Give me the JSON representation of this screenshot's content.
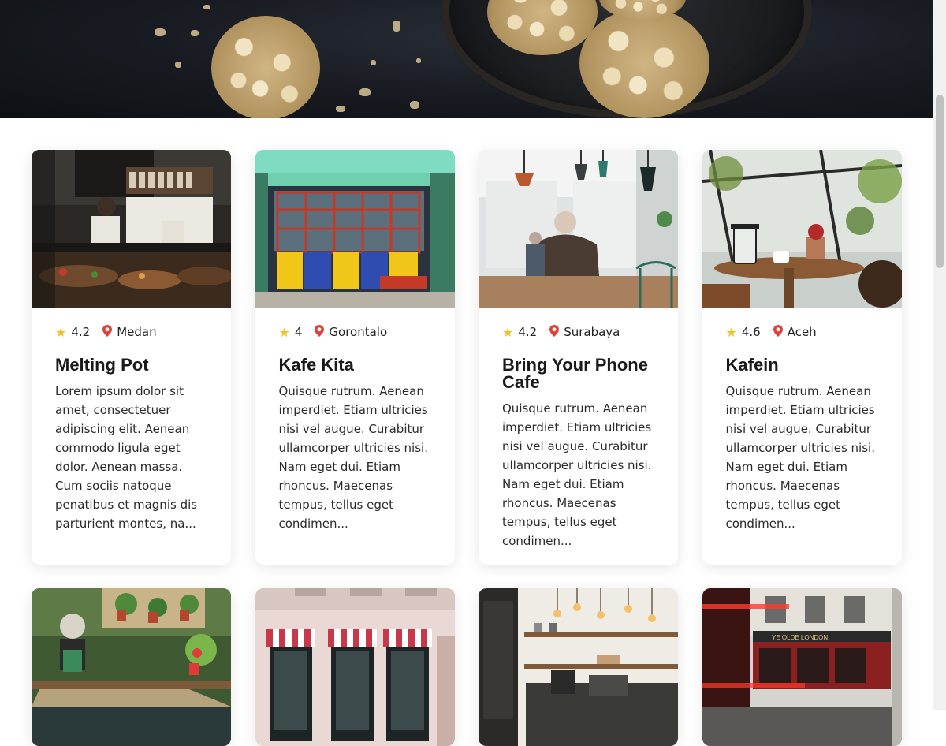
{
  "hero": {},
  "cards": [
    {
      "rating": "4.2",
      "location": "Medan",
      "title": "Melting Pot",
      "description": "Lorem ipsum dolor sit amet, consectetuer adipiscing elit. Aenean commodo ligula eget dolor. Aenean massa. Cum sociis natoque penatibus et magnis dis parturient montes, na..."
    },
    {
      "rating": "4",
      "location": "Gorontalo",
      "title": "Kafe Kita",
      "description": "Quisque rutrum. Aenean imperdiet. Etiam ultricies nisi vel augue. Curabitur ullamcorper ultricies nisi. Nam eget dui. Etiam rhoncus. Maecenas tempus, tellus eget condimen..."
    },
    {
      "rating": "4.2",
      "location": "Surabaya",
      "title": "Bring Your Phone Cafe",
      "description": "Quisque rutrum. Aenean imperdiet. Etiam ultricies nisi vel augue. Curabitur ullamcorper ultricies nisi. Nam eget dui. Etiam rhoncus. Maecenas tempus, tellus eget condimen..."
    },
    {
      "rating": "4.6",
      "location": "Aceh",
      "title": "Kafein",
      "description": "Quisque rutrum. Aenean imperdiet. Etiam ultricies nisi vel augue. Curabitur ullamcorper ultricies nisi. Nam eget dui. Etiam rhoncus. Maecenas tempus, tellus eget condimen..."
    }
  ],
  "icons": {
    "rating": "star-icon",
    "location": "map-pin-icon"
  },
  "colors": {
    "star": "#f2c12e",
    "pin": "#e0413b",
    "background": "#ffffff"
  }
}
